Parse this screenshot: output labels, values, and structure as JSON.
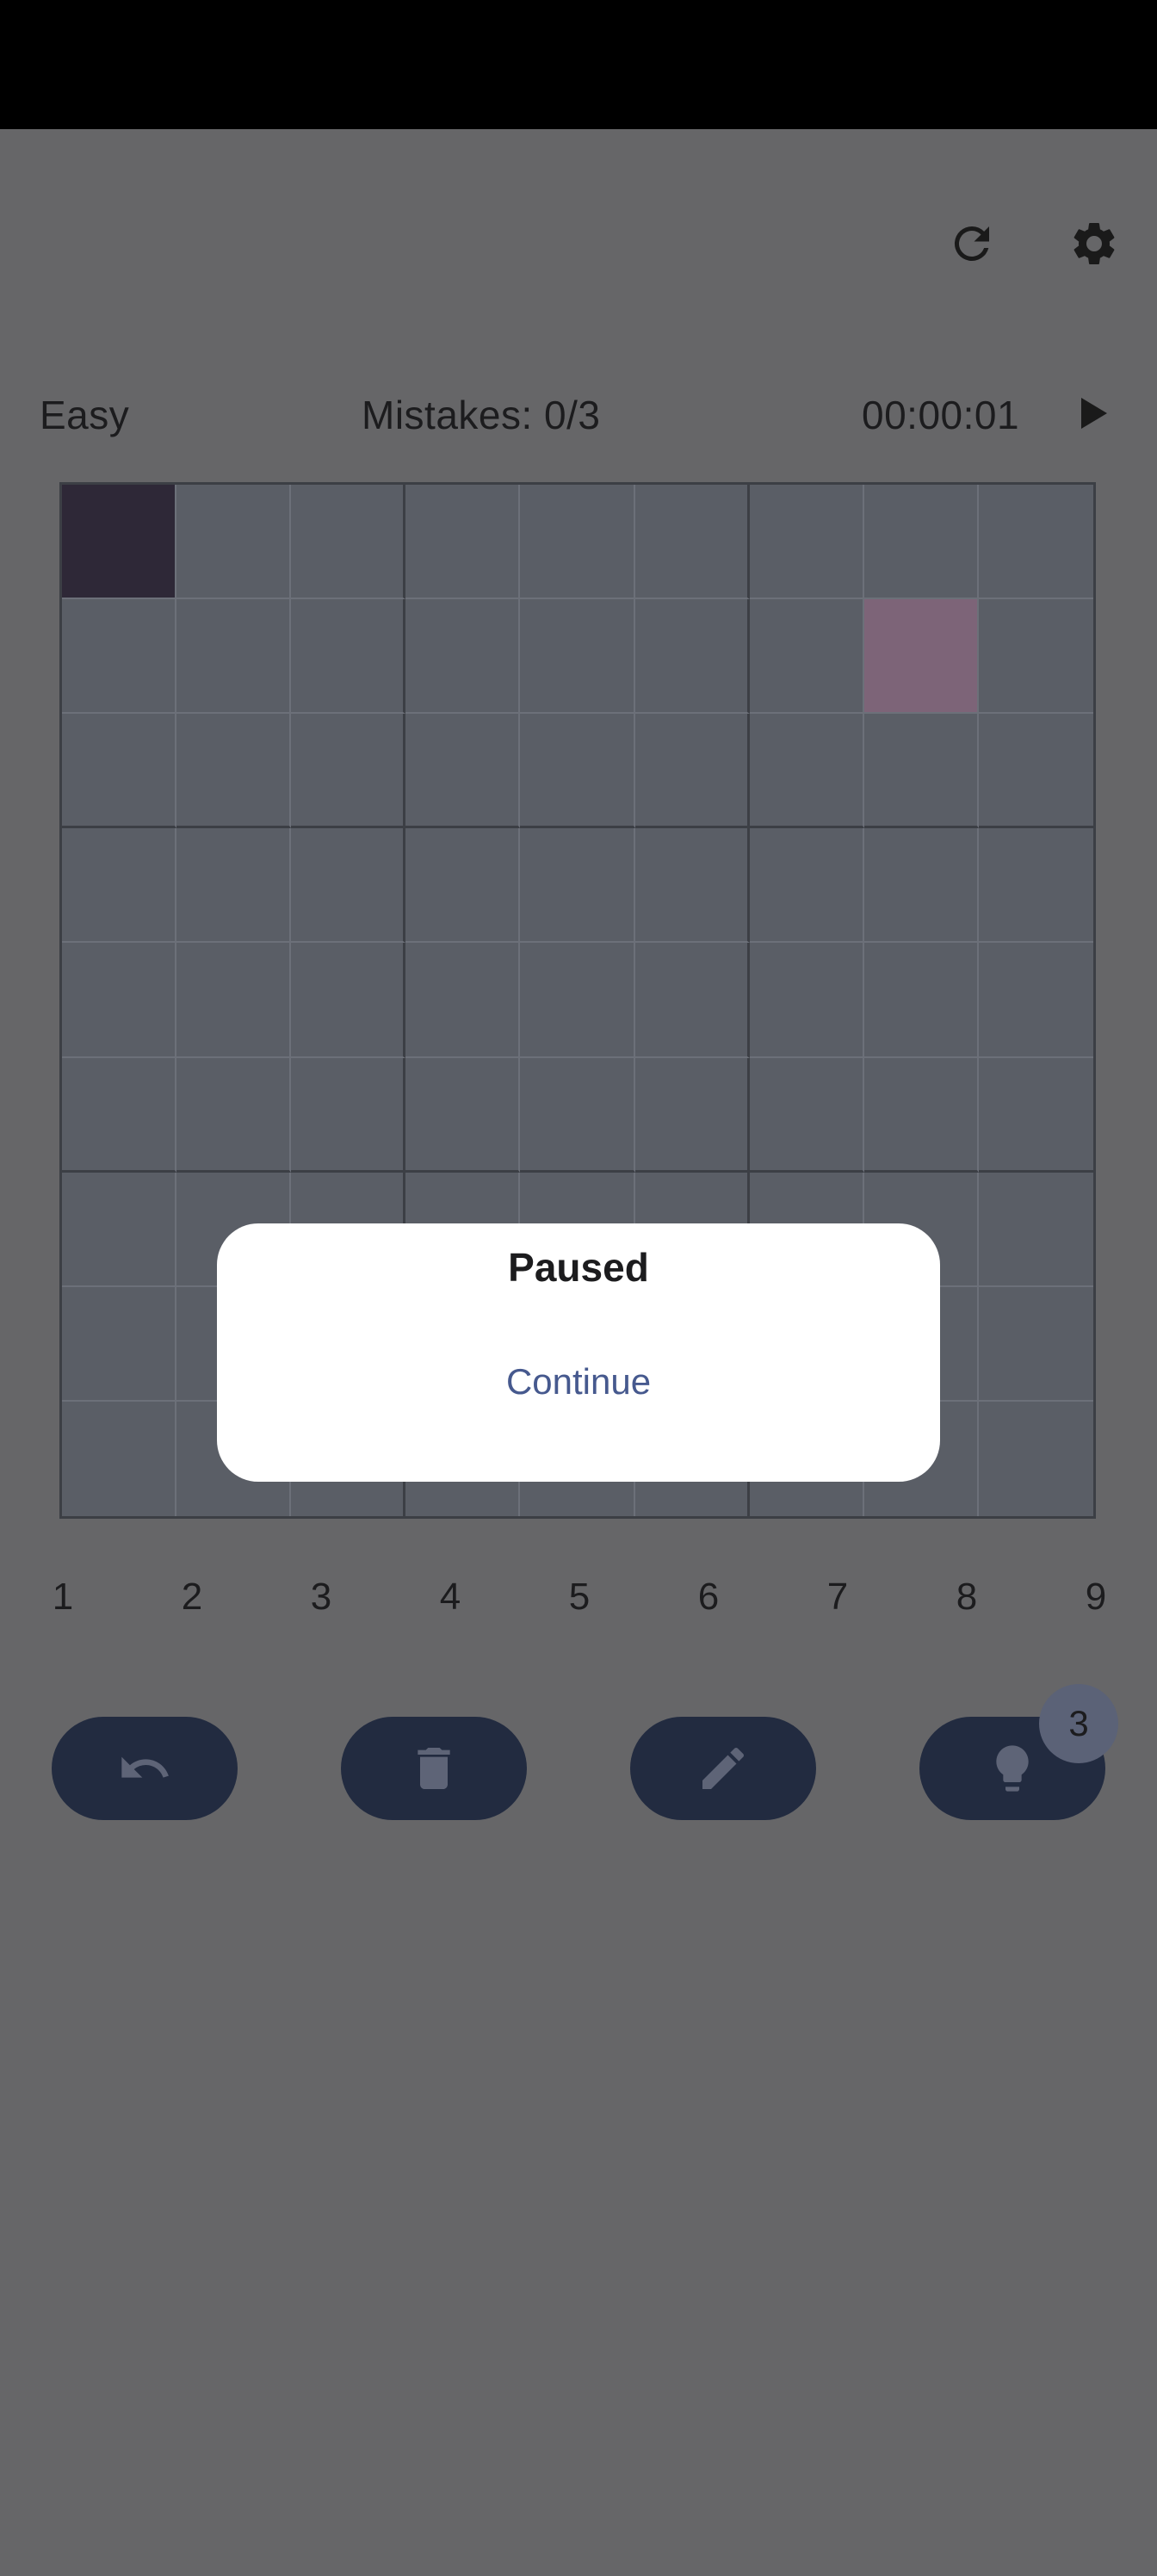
{
  "header": {
    "refresh_icon": "refresh-icon",
    "settings_icon": "gear-icon"
  },
  "info": {
    "difficulty": "Easy",
    "mistakes": "Mistakes: 0/3",
    "timer": "00:00:01",
    "play_icon": "play-icon"
  },
  "board": {
    "size": 9,
    "cells_with_values": [],
    "selected_cell": {
      "row": 1,
      "col": 1
    },
    "highlighted_cell": {
      "row": 2,
      "col": 8
    },
    "colors": {
      "cell": "#5a5e66",
      "selected": "#2e2837",
      "highlight": "#7d6478"
    }
  },
  "number_pad": [
    "1",
    "2",
    "3",
    "4",
    "5",
    "6",
    "7",
    "8",
    "9"
  ],
  "actions": {
    "undo_icon": "undo-icon",
    "erase_icon": "trash-icon",
    "notes_icon": "pencil-icon",
    "hint_icon": "lightbulb-icon",
    "hint_count": "3"
  },
  "dialog": {
    "title": "Paused",
    "continue_label": "Continue"
  },
  "colors": {
    "scrim": "#666668",
    "button_bg": "#222b40",
    "accent": "#46598e"
  }
}
